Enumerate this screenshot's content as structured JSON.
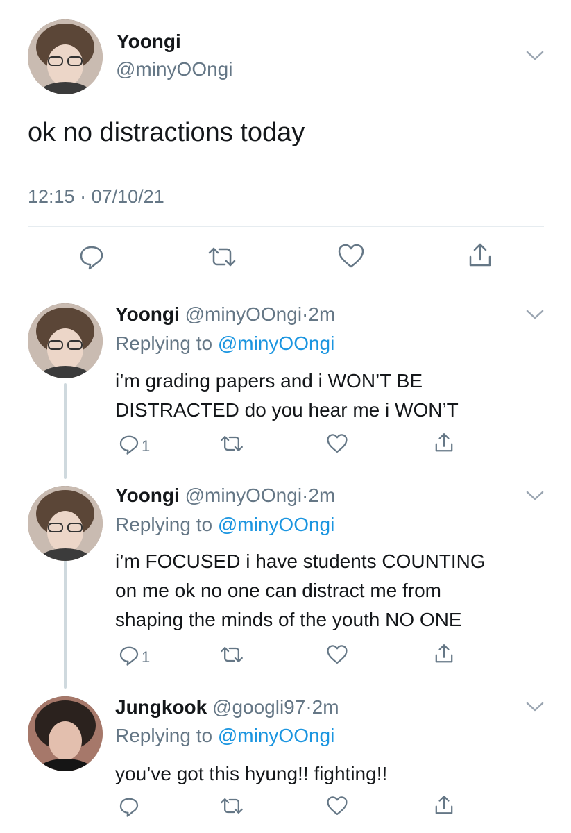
{
  "main_tweet": {
    "display_name": "Yoongi",
    "handle": "@minyOOngi",
    "text": "ok no distractions today",
    "time": "12:15",
    "sep": "·",
    "date": "07/10/21"
  },
  "replies": [
    {
      "display_name": "Yoongi",
      "handle": "@minyOOngi",
      "sep": "·",
      "age": "2m",
      "replying_prefix": "Replying to",
      "replying_handle": "@minyOOngi",
      "line1": "i’m grading papers and i WON’T BE",
      "line2": "DISTRACTED do you hear me i WON’T",
      "line3": "",
      "reply_count": "1"
    },
    {
      "display_name": "Yoongi",
      "handle": "@minyOOngi",
      "sep": "·",
      "age": "2m",
      "replying_prefix": "Replying to",
      "replying_handle": "@minyOOngi",
      "line1": "i’m FOCUSED i have students COUNTING",
      "line2": "on me ok no one can distract me from",
      "line3": "shaping the minds of the youth NO ONE",
      "reply_count": "1"
    },
    {
      "display_name": "Jungkook",
      "handle": "@googli97",
      "sep": "·",
      "age": "2m",
      "replying_prefix": "Replying to",
      "replying_handle": "@minyOOngi",
      "line1": "you’ve got this hyung!! fighting!!",
      "line2": "",
      "line3": "",
      "reply_count": ""
    }
  ],
  "icons": {
    "reply": "reply-icon",
    "retweet": "retweet-icon",
    "like": "heart-icon",
    "share": "share-icon",
    "more": "chevron-down-icon"
  },
  "colors": {
    "text": "#14171a",
    "muted": "#657786",
    "link": "#1b95e0",
    "divider": "#e6ecf0"
  }
}
